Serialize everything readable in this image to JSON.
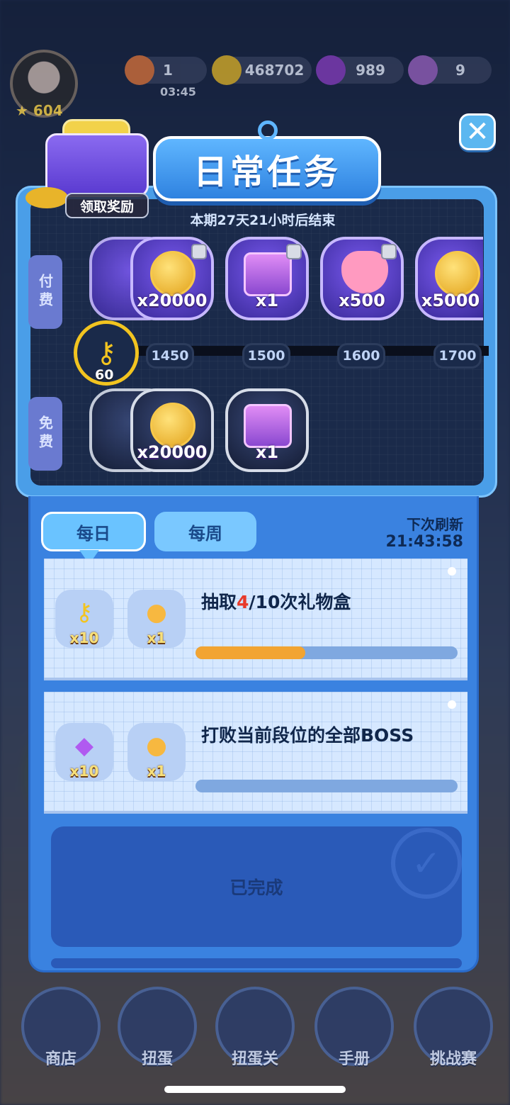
{
  "topbar": {
    "level": "604",
    "energy": "1",
    "energy_timer": "03:45",
    "coins": "468702",
    "gems": "989",
    "crowns": "9"
  },
  "modal": {
    "title": "日常任务",
    "claim_label": "领取奖励",
    "period_text": "本期27天21小时后结束",
    "paid_tab": "付费",
    "free_tab": "免费",
    "key_count": "60",
    "paid_rewards": [
      {
        "qty": "x20000",
        "icon": "coin-icon"
      },
      {
        "qty": "x1",
        "icon": "gift-box-icon"
      },
      {
        "qty": "x500",
        "icon": "heart-icon"
      },
      {
        "qty": "x5000",
        "icon": "coin-icon"
      }
    ],
    "milestones": [
      "1450",
      "1500",
      "1600",
      "1700"
    ],
    "free_rewards": [
      {
        "qty": "x20000",
        "icon": "coin-icon"
      },
      {
        "qty": "x1",
        "icon": "gift-box-icon"
      }
    ]
  },
  "tasks": {
    "tab_daily": "每日",
    "tab_weekly": "每周",
    "refresh_label": "下次刷新",
    "refresh_time": "21:43:58",
    "items": [
      {
        "title_prefix": "抽取",
        "title_highlight": "4",
        "title_suffix": "/10次礼物盒",
        "reward1_qty": "x10",
        "reward2_qty": "x1",
        "progress": 0.42
      },
      {
        "title": "打败当前段位的全部BOSS",
        "reward1_qty": "x10",
        "reward2_qty": "x1",
        "progress": 0
      }
    ],
    "completed_label": "已完成"
  },
  "nav": {
    "shop": "商店",
    "gacha": "扭蛋",
    "gacha_level": "扭蛋关",
    "album": "手册",
    "challenge": "挑战赛"
  },
  "colors": {
    "panel_blue": "#4a9ee8",
    "panel_dark": "#1a2a4a",
    "progress_fill": "#f2a432",
    "highlight_red": "#e83a2a"
  }
}
